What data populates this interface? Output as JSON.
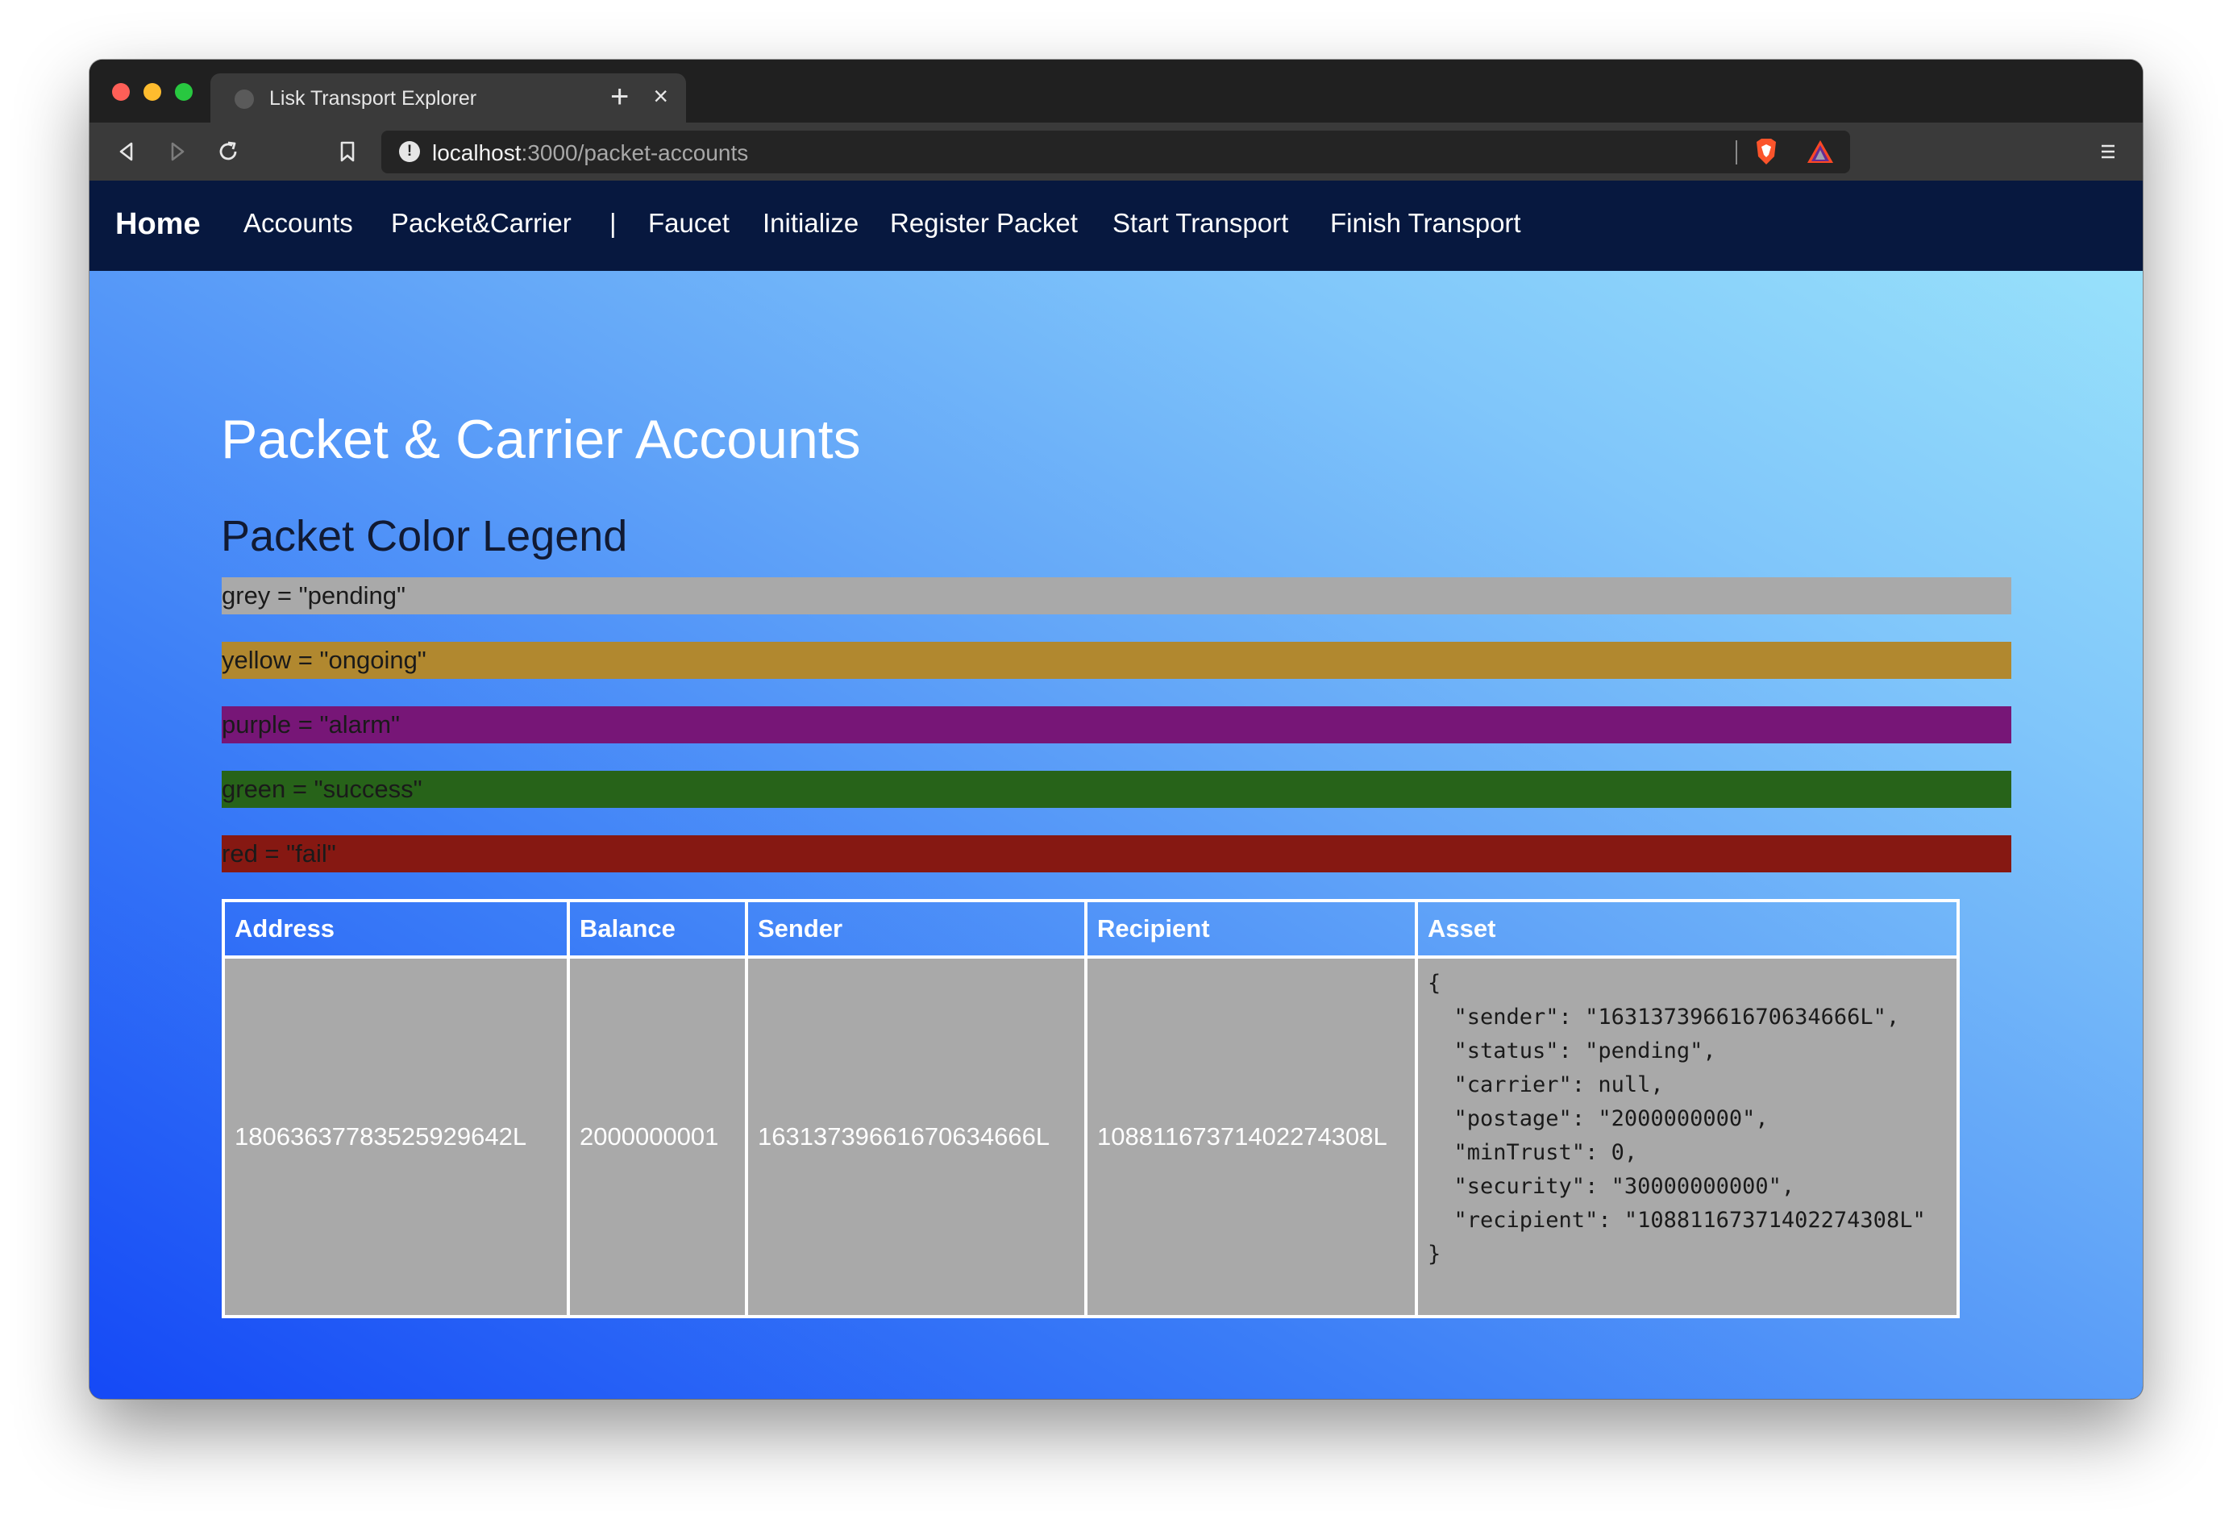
{
  "browser": {
    "tab_title": "Lisk Transport Explorer",
    "tab_close": "×",
    "new_tab": "+",
    "url_host": "localhost",
    "url_path": ":3000/packet-accounts",
    "icons": [
      "back-icon",
      "forward-icon",
      "reload-icon",
      "bookmark-icon",
      "info-icon",
      "brave-shield-icon",
      "brave-rewards-icon",
      "menu-icon"
    ]
  },
  "navbar": {
    "brand": "Home",
    "items": [
      "Accounts",
      "Packet&Carrier",
      "|",
      "Faucet",
      "Initialize",
      "Register Packet",
      "Start Transport",
      "Finish Transport"
    ]
  },
  "page": {
    "title": "Packet & Carrier Accounts",
    "legend_title": "Packet Color Legend",
    "legend": [
      {
        "label": "grey = \"pending\"",
        "color": "#a9a9a9"
      },
      {
        "label": "yellow = \"ongoing\"",
        "color": "#b1882f"
      },
      {
        "label": "purple = \"alarm\"",
        "color": "#771677"
      },
      {
        "label": "green = \"success\"",
        "color": "#276319"
      },
      {
        "label": "red = \"fail\"",
        "color": "#861812"
      }
    ]
  },
  "table": {
    "headers": [
      "Address",
      "Balance",
      "Sender",
      "Recipient",
      "Asset"
    ],
    "rows": [
      {
        "address": "18063637783525929642L",
        "balance": "2000000001",
        "sender": "16313739661670634666L",
        "recipient": "10881167371402274308L",
        "asset": "{\n  \"sender\": \"16313739661670634666L\",\n  \"status\": \"pending\",\n  \"carrier\": null,\n  \"postage\": \"2000000000\",\n  \"minTrust\": 0,\n  \"security\": \"30000000000\",\n  \"recipient\": \"10881167371402274308L\"\n}",
        "status_color": "#a9a9a9"
      }
    ]
  }
}
